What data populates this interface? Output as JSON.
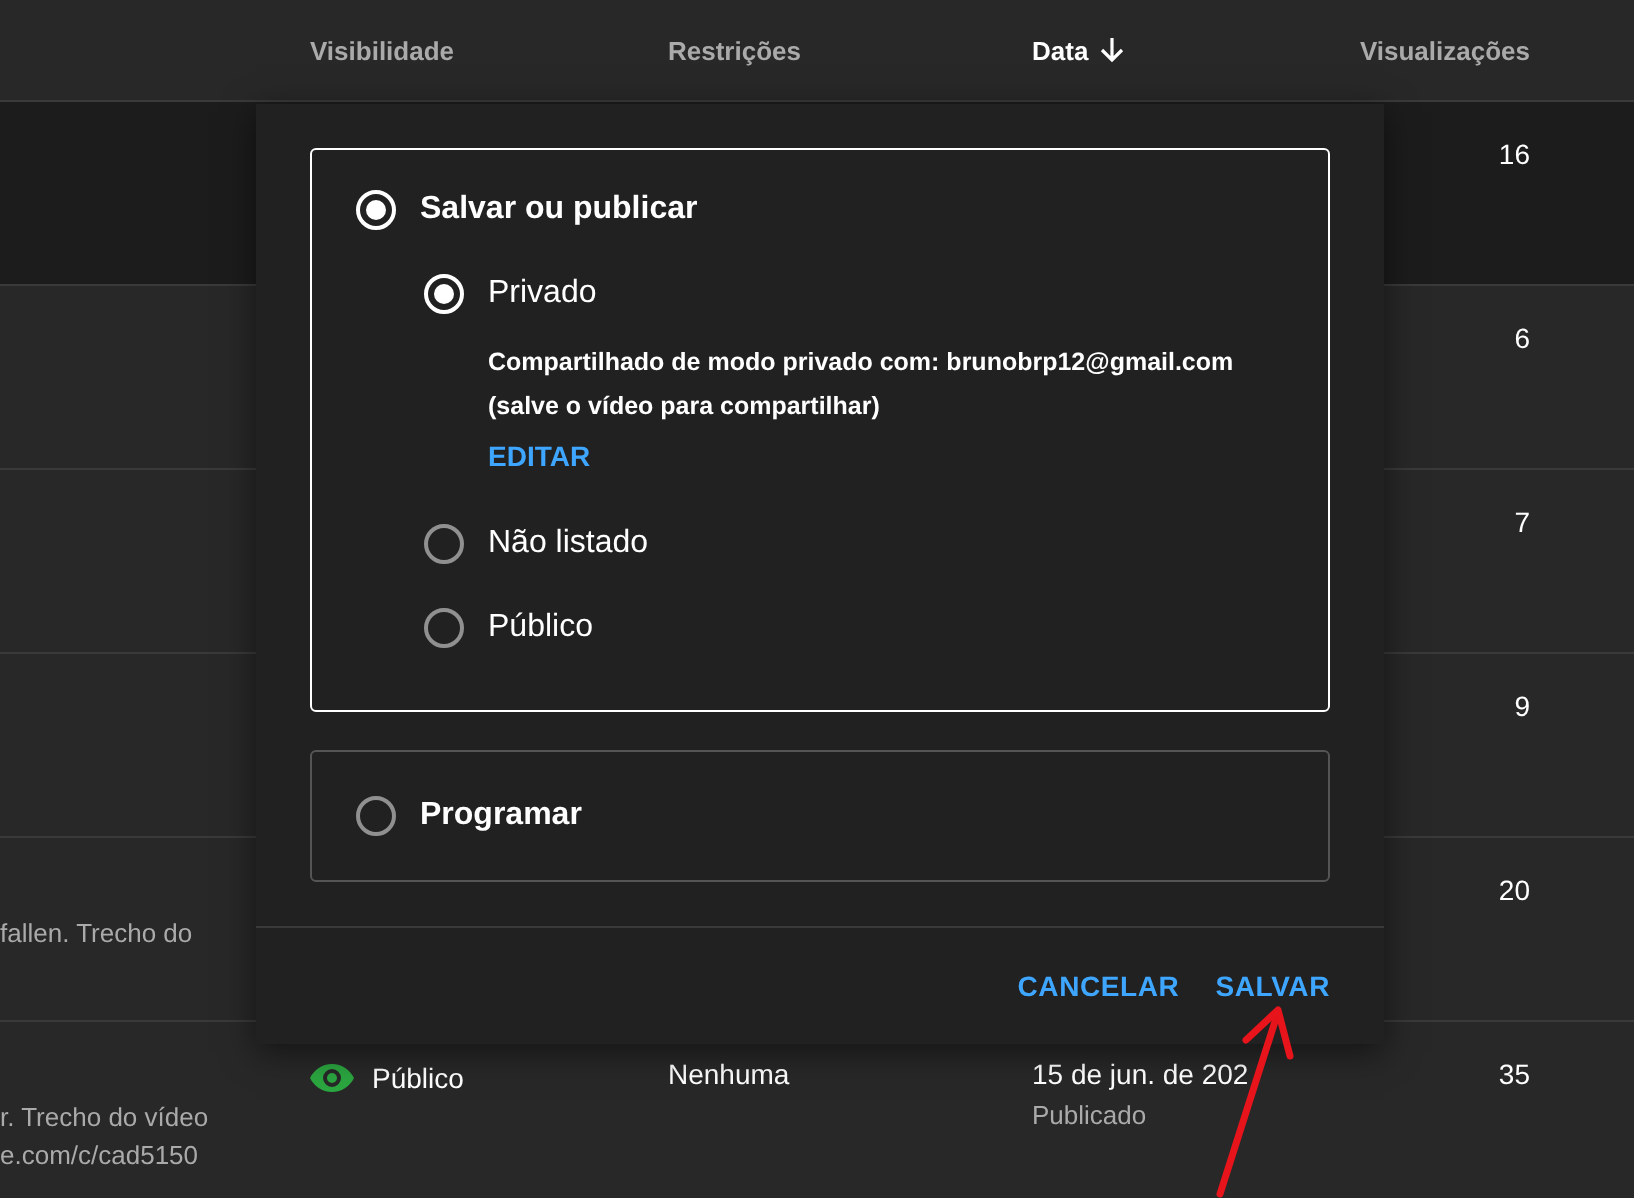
{
  "table": {
    "columns": [
      {
        "label": "Visibilidade",
        "sorted": false
      },
      {
        "label": "Restrições",
        "sorted": false
      },
      {
        "label": "Data",
        "sorted": true
      },
      {
        "label": "Visualizações",
        "sorted": false
      }
    ],
    "rows": [
      {
        "highlighted": true,
        "views": "16"
      },
      {
        "highlighted": false,
        "views": "6"
      },
      {
        "highlighted": false,
        "views": "7"
      },
      {
        "highlighted": false,
        "views": "9"
      },
      {
        "highlighted": false,
        "description": [
          "fallen. Trecho do"
        ],
        "views": "20"
      },
      {
        "highlighted": false,
        "description": [
          "r. Trecho do vídeo",
          "e.com/c/cad5150"
        ],
        "visibility": "Público",
        "restrictions": "Nenhuma",
        "date": "15 de jun. de 202",
        "date_status": "Publicado",
        "views": "35"
      }
    ]
  },
  "dialog": {
    "publish": {
      "label": "Salvar ou publicar",
      "selected": true,
      "visibility_options": [
        {
          "label": "Privado",
          "selected": true
        },
        {
          "label": "Não listado",
          "selected": false
        },
        {
          "label": "Público",
          "selected": false
        }
      ],
      "share_note": [
        "Compartilhado de modo privado com: brunobrp12@gmail.com",
        "(salve o vídeo para compartilhar)"
      ],
      "edit_link": "EDITAR"
    },
    "schedule": {
      "label": "Programar",
      "selected": false
    },
    "buttons": [
      "CANCELAR",
      "SALVAR"
    ]
  }
}
